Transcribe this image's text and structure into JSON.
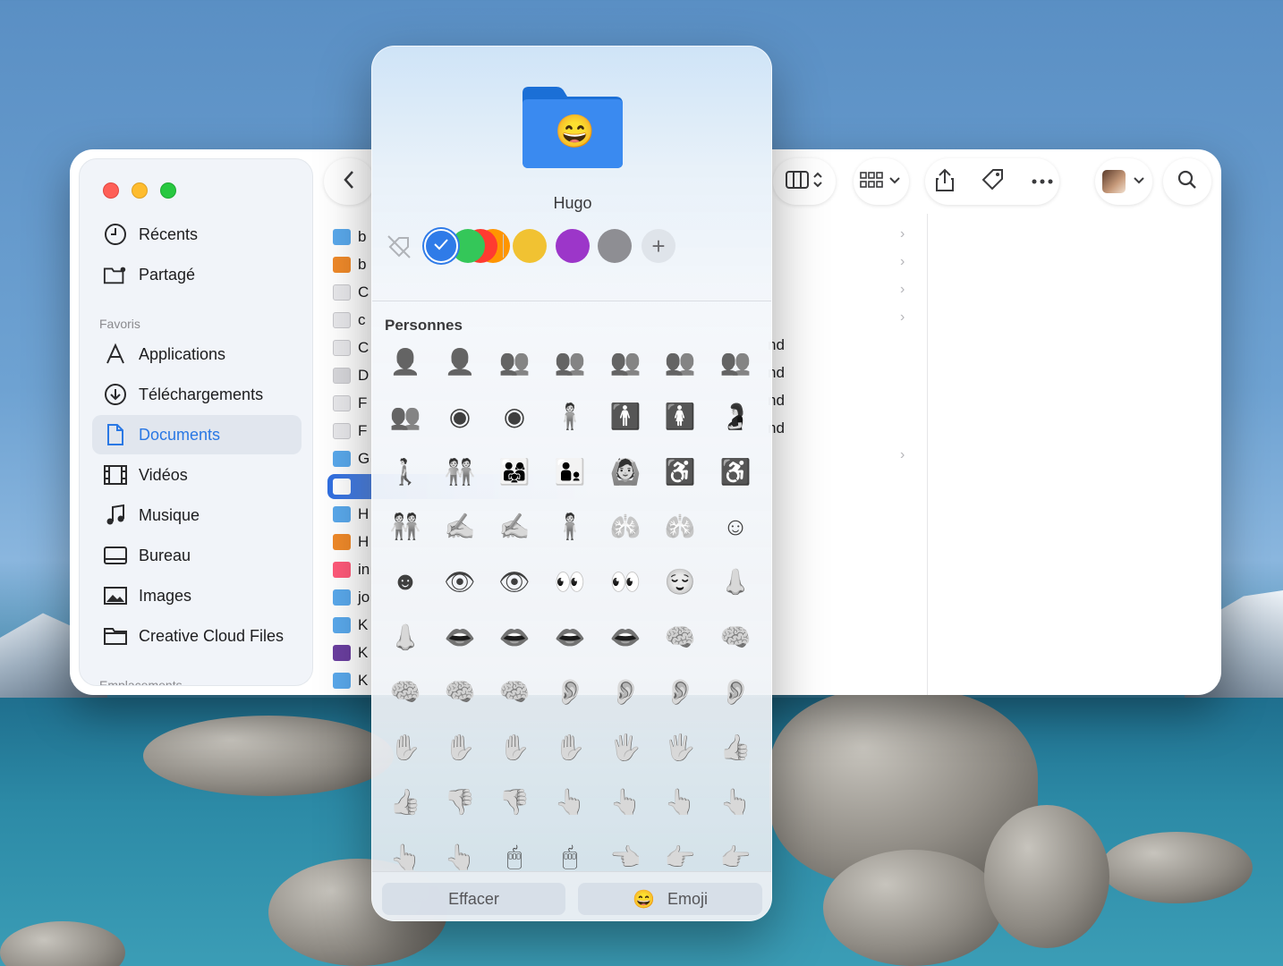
{
  "finder": {
    "sidebar": {
      "items_top": [
        {
          "label": "Récents",
          "icon": "clock-icon"
        },
        {
          "label": "Partagé",
          "icon": "shared-folder-icon"
        }
      ],
      "favoris_label": "Favoris",
      "favoris": [
        {
          "label": "Applications",
          "icon": "applications-icon"
        },
        {
          "label": "Téléchargements",
          "icon": "download-icon"
        },
        {
          "label": "Documents",
          "icon": "document-icon",
          "active": true
        },
        {
          "label": "Vidéos",
          "icon": "film-icon"
        },
        {
          "label": "Musique",
          "icon": "music-note-icon"
        },
        {
          "label": "Bureau",
          "icon": "desktop-icon"
        },
        {
          "label": "Images",
          "icon": "photo-icon"
        },
        {
          "label": "Creative Cloud Files",
          "icon": "folder-icon"
        }
      ],
      "emplacements_label": "Emplacements"
    },
    "files": [
      {
        "initial": "b",
        "kind": "folder"
      },
      {
        "initial": "b",
        "kind": "archive"
      },
      {
        "initial": "C",
        "kind": "doc"
      },
      {
        "initial": "c",
        "kind": "doc"
      },
      {
        "initial": "C",
        "kind": "doc"
      },
      {
        "initial": "D",
        "kind": "disk"
      },
      {
        "initial": "F",
        "kind": "doc"
      },
      {
        "initial": "F",
        "kind": "doc"
      },
      {
        "initial": "G",
        "kind": "folder"
      },
      {
        "initial": "",
        "kind": "selected-folder"
      },
      {
        "initial": "H",
        "kind": "folder"
      },
      {
        "initial": "H",
        "kind": "archive"
      },
      {
        "initial": "in",
        "kind": "image"
      },
      {
        "initial": "jo",
        "kind": "folder"
      },
      {
        "initial": "K",
        "kind": "folder"
      },
      {
        "initial": "K",
        "kind": "app"
      },
      {
        "initial": "K",
        "kind": "folder"
      }
    ],
    "right_suffixes": [
      "nd",
      "nd",
      "nd",
      "nd"
    ]
  },
  "popover": {
    "folder_emoji": "😄",
    "folder_name": "Hugo",
    "colors": {
      "selected_blue": "#2f7be8",
      "green": "#34c759",
      "red": "#ff3b30",
      "orange": "#ff9500",
      "yellow": "#f1c232",
      "purple": "#9c36c9",
      "gray": "#8e8e93"
    },
    "add_label": "+",
    "section_title": "Personnes",
    "symbols": [
      [
        "👤",
        "👤",
        "👥",
        "👥",
        "👥",
        "👥",
        "👥"
      ],
      [
        "👥",
        "◉",
        "◉",
        "🧍",
        "🚹",
        "🚺",
        "🤰"
      ],
      [
        "🚶",
        "🧑‍🤝‍🧑",
        "👨‍👩‍👧",
        "🧑‍🧒",
        "🙆",
        "♿",
        "♿"
      ],
      [
        "🧑‍🤝‍🧑",
        "✍",
        "✍",
        "🧍",
        "🫁",
        "🫁",
        "☺"
      ],
      [
        "☻",
        "👁",
        "👁",
        "👀",
        "👀",
        "😌",
        "👃"
      ],
      [
        "👃",
        "👄",
        "👄",
        "👄",
        "👄",
        "🧠",
        "🧠"
      ],
      [
        "🧠",
        "🧠",
        "🧠",
        "👂",
        "👂",
        "👂",
        "👂"
      ],
      [
        "✋",
        "✋",
        "✋",
        "✋",
        "🖐",
        "🖐",
        "👍"
      ],
      [
        "👍",
        "👎",
        "👎",
        "👆",
        "👆",
        "👆",
        "👆"
      ],
      [
        "👆",
        "👆",
        "🖱",
        "🖱",
        "👈",
        "👉",
        "👉"
      ]
    ],
    "clear_label": "Effacer",
    "emoji_glyph": "😄",
    "emoji_label": "Emoji"
  }
}
